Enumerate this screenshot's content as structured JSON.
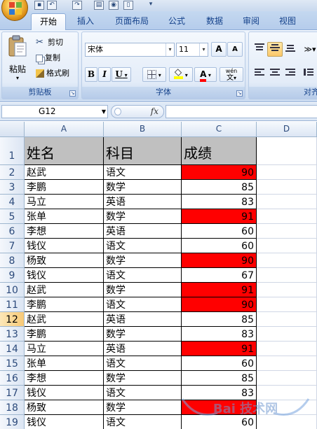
{
  "tabs": [
    "开始",
    "插入",
    "页面布局",
    "公式",
    "数据",
    "审阅",
    "视图"
  ],
  "active_tab": "开始",
  "ribbon": {
    "clipboard": {
      "paste": "粘贴",
      "cut": "剪切",
      "copy": "复制",
      "format_painter": "格式刷",
      "label": "剪贴板"
    },
    "font": {
      "name": "宋体",
      "size": "11",
      "label": "字体",
      "bold": "B",
      "italic": "I",
      "underline": "U",
      "font_color_letter": "A",
      "grow": "A",
      "shrink": "A",
      "wen": "wén",
      "wen_char": "文"
    },
    "alignment": {
      "label": "对齐"
    }
  },
  "formula_bar": {
    "name_box": "G12",
    "fx": "fx"
  },
  "columns": [
    "A",
    "B",
    "C",
    "D"
  ],
  "selected_row": 12,
  "header_row": {
    "row": "1",
    "cells": [
      "姓名",
      "科目",
      "成绩"
    ]
  },
  "rows": [
    {
      "row": "2",
      "name": "赵武",
      "subject": "语文",
      "score": "90",
      "highlight": true
    },
    {
      "row": "3",
      "name": "李鹏",
      "subject": "数学",
      "score": "85",
      "highlight": false
    },
    {
      "row": "4",
      "name": "马立",
      "subject": "英语",
      "score": "83",
      "highlight": false
    },
    {
      "row": "5",
      "name": "张单",
      "subject": "数学",
      "score": "91",
      "highlight": true
    },
    {
      "row": "6",
      "name": "李想",
      "subject": "英语",
      "score": "60",
      "highlight": false
    },
    {
      "row": "7",
      "name": "钱仪",
      "subject": "语文",
      "score": "60",
      "highlight": false
    },
    {
      "row": "8",
      "name": "杨致",
      "subject": "数学",
      "score": "90",
      "highlight": true
    },
    {
      "row": "9",
      "name": "钱仪",
      "subject": "语文",
      "score": "67",
      "highlight": false
    },
    {
      "row": "10",
      "name": "赵武",
      "subject": "数学",
      "score": "91",
      "highlight": true
    },
    {
      "row": "11",
      "name": "李鹏",
      "subject": "语文",
      "score": "90",
      "highlight": true
    },
    {
      "row": "12",
      "name": "赵武",
      "subject": "英语",
      "score": "85",
      "highlight": false
    },
    {
      "row": "13",
      "name": "李鹏",
      "subject": "数学",
      "score": "83",
      "highlight": false
    },
    {
      "row": "14",
      "name": "马立",
      "subject": "英语",
      "score": "91",
      "highlight": true
    },
    {
      "row": "15",
      "name": "张单",
      "subject": "语文",
      "score": "60",
      "highlight": false
    },
    {
      "row": "16",
      "name": "李想",
      "subject": "数学",
      "score": "85",
      "highlight": false
    },
    {
      "row": "17",
      "name": "钱仪",
      "subject": "语文",
      "score": "83",
      "highlight": false
    },
    {
      "row": "18",
      "name": "杨致",
      "subject": "数学",
      "score": "",
      "highlight": true
    },
    {
      "row": "19",
      "name": "钱仪",
      "subject": "语文",
      "score": "60",
      "highlight": false
    }
  ],
  "watermark": "Bai 技术网",
  "colors": {
    "highlight": "#ff0000",
    "header_fill": "#c0c0c0",
    "ribbon_text": "#15428b"
  }
}
